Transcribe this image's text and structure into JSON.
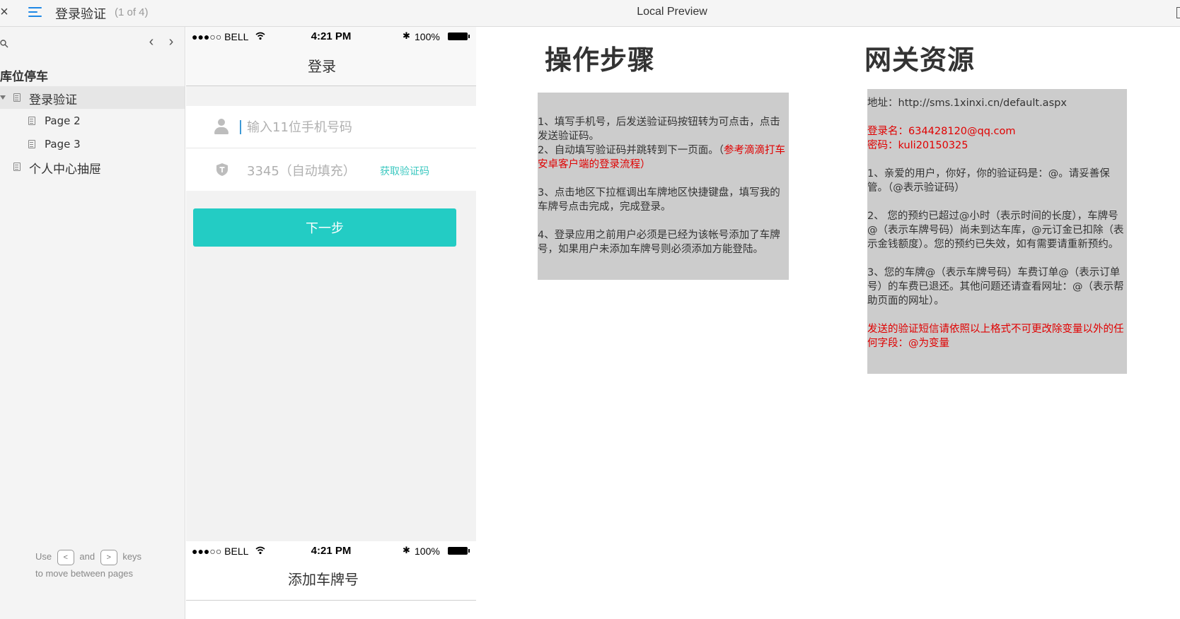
{
  "topbar": {
    "close": "×",
    "page_name": "登录验证",
    "page_count": "(1 of 4)",
    "title": "Local Preview"
  },
  "sidebar": {
    "nav_prev": "‹",
    "nav_next": "›",
    "project_title": "库位停车",
    "items": [
      {
        "label": "登录验证"
      },
      {
        "label": "Page 2"
      },
      {
        "label": "Page 3"
      },
      {
        "label": "个人中心抽屉"
      }
    ],
    "hint": {
      "use": "Use",
      "and": "and",
      "keys": "keys",
      "key_prev": "<",
      "key_next": ">",
      "line2": "to move between pages"
    }
  },
  "phone_login": {
    "status": {
      "carrier": "●●●○○ BELL",
      "time": "4:21 PM",
      "bluetooth": "✱",
      "battery": "100%"
    },
    "title": "登录",
    "phone_placeholder": "输入11位手机号码",
    "code_value": "3345（自动填充）",
    "get_code": "获取验证码",
    "next_button": "下一步"
  },
  "phone_plate": {
    "status": {
      "carrier": "●●●○○ BELL",
      "time": "4:21 PM",
      "bluetooth": "✱",
      "battery": "100%"
    },
    "title": "添加车牌号"
  },
  "steps": {
    "heading": "操作步骤",
    "p1": "1、填写手机号，后发送验证码按钮转为可点击，点击发送验证码。",
    "p2_start": "2、自动填写验证码并跳转到下一页面。（",
    "p2_red": "参考滴滴打车安卓客户端的登录流程）",
    "p3": "3、点击地区下拉框调出车牌地区快捷键盘，填写我的车牌号点击完成，完成登录。",
    "p4": "4、登录应用之前用户必须是已经为该帐号添加了车牌号，如果用户未添加车牌号则必须添加方能登陆。"
  },
  "gateway": {
    "heading": "网关资源",
    "address": "地址：http://sms.1xinxi.cn/default.aspx",
    "login_name": "登录名：634428120@qq.com",
    "password": "密码：kuli20150325",
    "t1": "1、亲爱的用户，你好，你的验证码是：@。请妥善保管。（@表示验证码）",
    "t2": "2、 您的预约已超过@小时（表示时间的长度），车牌号@（表示车牌号码）尚未到达车库，@元订金已扣除（表示金钱额度）。您的预约已失效，如有需要请重新预约。",
    "t3": " 3、您的车牌@（表示车牌号码）车费订单@（表示订单号）的车费已退还。其他问题还请查看网址：@（表示帮助页面的网址）。",
    "warning": "发送的验证短信请依照以上格式不可更改除变量以外的任何字段：@为变量"
  },
  "colors": {
    "accent": "#23ccc4",
    "link": "#3cc8c0",
    "warning_red": "#e00000",
    "note_bg": "#cccccc",
    "menu_blue": "#1e88e5"
  }
}
